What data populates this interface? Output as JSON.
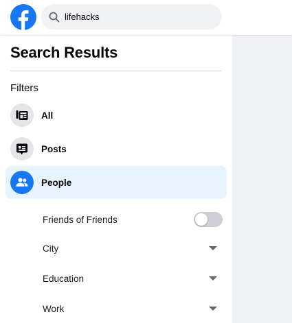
{
  "search": {
    "value": "lifehacks"
  },
  "sidebar": {
    "title": "Search Results",
    "filters_heading": "Filters",
    "nav": [
      {
        "label": "All",
        "icon": "feed-icon",
        "active": false
      },
      {
        "label": "Posts",
        "icon": "posts-icon",
        "active": false
      },
      {
        "label": "People",
        "icon": "people-icon",
        "active": true
      }
    ],
    "people_filters": {
      "friends_of_friends": {
        "label": "Friends of Friends",
        "enabled": false
      },
      "dropdowns": [
        {
          "label": "City",
          "icon": "chevron-down-icon"
        },
        {
          "label": "Education",
          "icon": "chevron-down-icon"
        },
        {
          "label": "Work",
          "icon": "chevron-down-icon"
        }
      ]
    }
  },
  "colors": {
    "brand": "#1877f2",
    "active_bg": "#e7f3ff",
    "icon_bg": "#e4e6eb",
    "page_bg": "#f0f2f5",
    "toggle_off": "#ccd0d5"
  }
}
